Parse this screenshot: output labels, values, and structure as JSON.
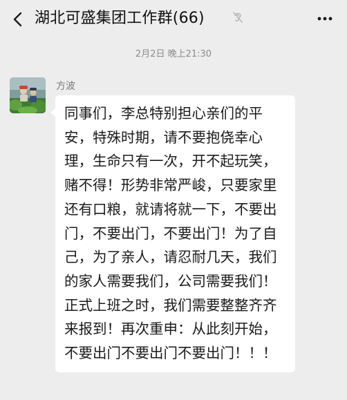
{
  "header": {
    "title": "湖北可盛集团工作群(66)",
    "back_icon": "chevron-left-icon",
    "mute_icon": "ear-muted-icon",
    "more_icon": "more-dots-icon"
  },
  "timestamp": "2月2日 晚上21:30",
  "message": {
    "sender": "方波",
    "avatar_icon": "avatar-image",
    "text": "同事们，李总特别担心亲们的平安，特殊时期，请不要抱侥幸心理，生命只有一次，开不起玩笑，赌不得！形势非常严峻，只要家里还有口粮，就请将就一下，不要出门，不要出门，不要出门！为了自己，为了亲人，请忍耐几天，我们的家人需要我们，公司需要我们！正式上班之时，我们需要整整齐齐来报到！再次重申：从此刻开始，不要出门不要出门不要出门！！！"
  },
  "colors": {
    "background": "#ededed",
    "bubble": "#ffffff",
    "text": "#1a1a1a",
    "muted_text": "#8c8c8c"
  }
}
